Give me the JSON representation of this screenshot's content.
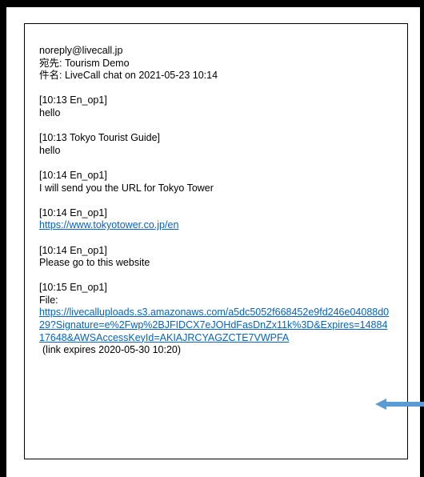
{
  "header": {
    "from": "noreply@livecall.jp",
    "to": "宛先: Tourism Demo",
    "subject": "件名: LiveCall chat on 2021-05-23 10:14"
  },
  "messages": [
    {
      "meta": "[10:13 En_op1]",
      "text": "hello"
    },
    {
      "meta": "[10:13 Tokyo Tourist Guide]",
      "text": "hello"
    },
    {
      "meta": "[10:14 En_op1]",
      "text": "I will send you the URL for Tokyo Tower"
    },
    {
      "meta": "[10:14 En_op1]",
      "link": "https://www.tokyotower.co.jp/en"
    },
    {
      "meta": "[10:14 En_op1]",
      "text": "Please go to this website"
    }
  ],
  "file_message": {
    "meta": "[10:15 En_op1]",
    "label": "File:",
    "link": "https://livecalluploads.s3.amazonaws.com/a5dc5052f668452e9fd246e04088d029?Signature=e%2Fwp%2BJFIDCX7eJOHdFasDnZx11k%3D&Expires=1488417648&AWSAccessKeyId=AKIAJRCYAGZCTE7VWPFA",
    "expiry": "(link expires 2020-05-30 10:20)"
  },
  "colors": {
    "link": "#0563c1",
    "arrow": "#5b9bd5",
    "frame": "#000000"
  },
  "annotation": {
    "icon": "arrow-left-icon"
  }
}
